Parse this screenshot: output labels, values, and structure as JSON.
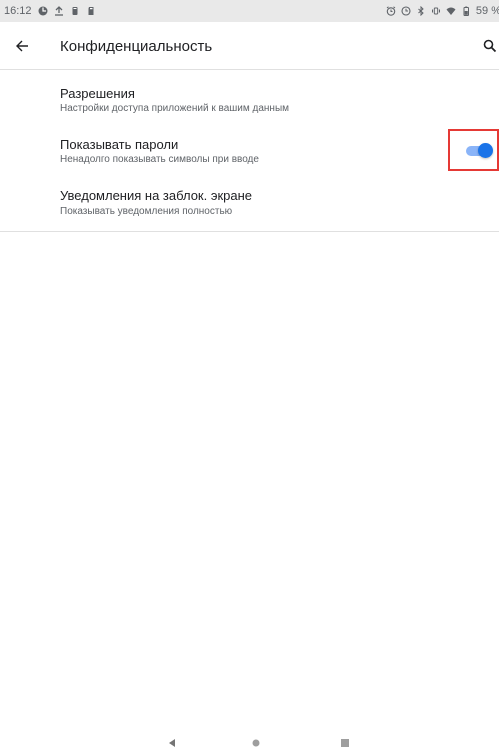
{
  "status_bar": {
    "time": "16:12",
    "battery_text": "59 %"
  },
  "header": {
    "title": "Конфиденциальность"
  },
  "settings": [
    {
      "title": "Разрешения",
      "subtitle": "Настройки доступа приложений к вашим данным"
    },
    {
      "title": "Показывать пароли",
      "subtitle": "Ненадолго показывать символы при вводе",
      "toggle_on": true
    },
    {
      "title": "Уведомления на заблок. экране",
      "subtitle": "Показывать уведомления полностью"
    }
  ],
  "colors": {
    "accent": "#1a73e8",
    "accent_track": "#8ab4f8",
    "highlight": "#e53935",
    "status_bar_bg": "#e9e9e9"
  },
  "icons": {
    "back": "arrow-back-icon",
    "search": "search-icon"
  }
}
